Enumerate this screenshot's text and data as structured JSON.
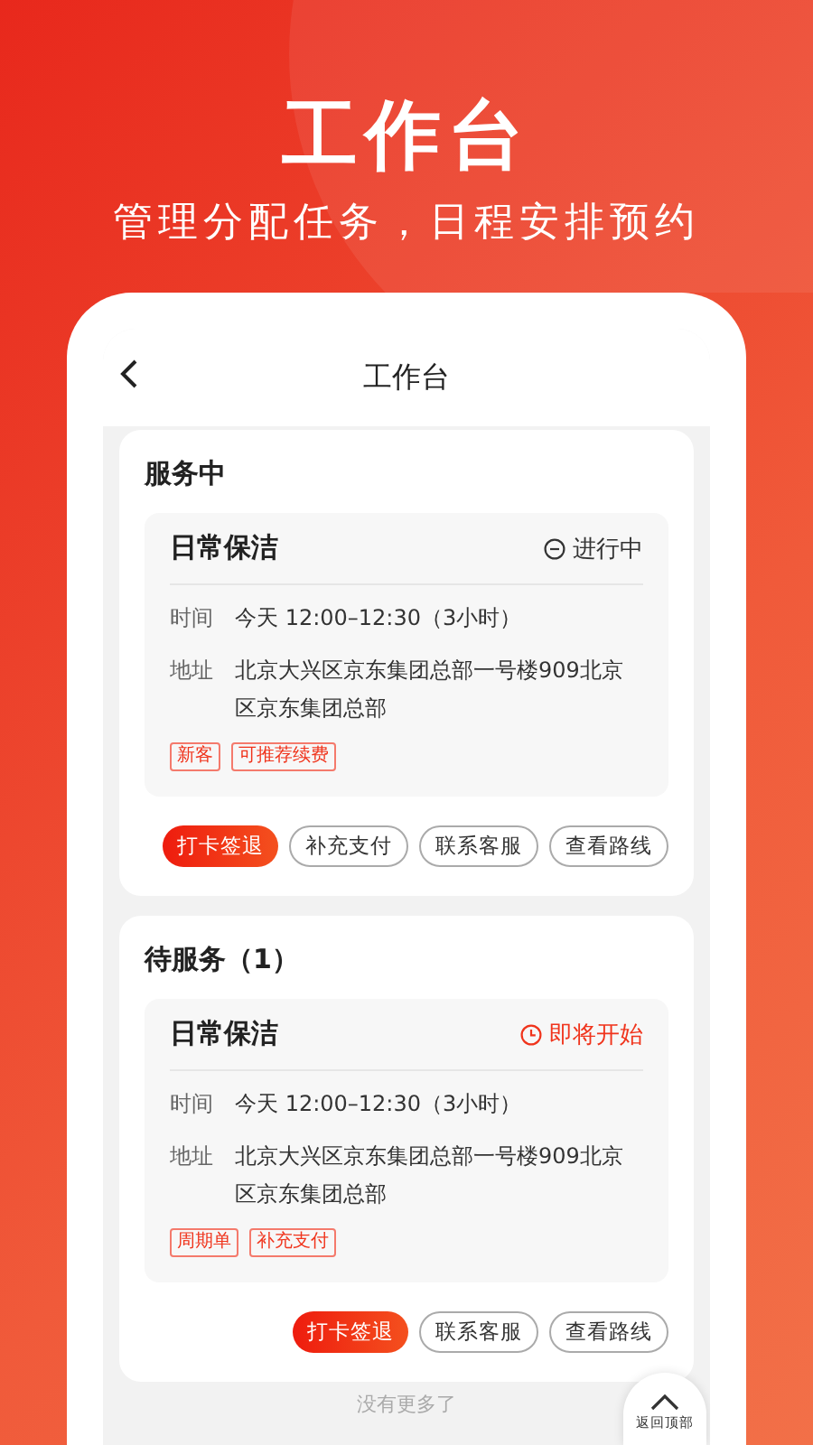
{
  "hero": {
    "title": "工作台",
    "subtitle": "管理分配任务，日程安排预约"
  },
  "screen": {
    "title": "工作台"
  },
  "sections": [
    {
      "heading": "服务中",
      "order": {
        "name": "日常保洁",
        "status": {
          "kind": "in_progress",
          "label": "进行中"
        },
        "time_label": "时间",
        "time": "今天 12:00–12:30（3小时）",
        "address_label": "地址",
        "address": "北京大兴区京东集团总部一号楼909北京区京东集团总部",
        "tags": [
          "新客",
          "可推荐续费"
        ]
      },
      "buttons": [
        {
          "kind": "primary",
          "label": "打卡签退"
        },
        {
          "kind": "outline",
          "label": "补充支付"
        },
        {
          "kind": "outline",
          "label": "联系客服"
        },
        {
          "kind": "outline",
          "label": "查看路线"
        }
      ]
    },
    {
      "heading": "待服务（1）",
      "order": {
        "name": "日常保洁",
        "status": {
          "kind": "upcoming",
          "label": "即将开始"
        },
        "time_label": "时间",
        "time": "今天 12:00–12:30（3小时）",
        "address_label": "地址",
        "address": "北京大兴区京东集团总部一号楼909北京区京东集团总部",
        "tags": [
          "周期单",
          "补充支付"
        ]
      },
      "buttons": [
        {
          "kind": "primary",
          "label": "打卡签退"
        },
        {
          "kind": "outline",
          "label": "联系客服"
        },
        {
          "kind": "outline",
          "label": "查看路线"
        }
      ]
    }
  ],
  "footer": "没有更多了",
  "back_to_top": "返回顶部"
}
